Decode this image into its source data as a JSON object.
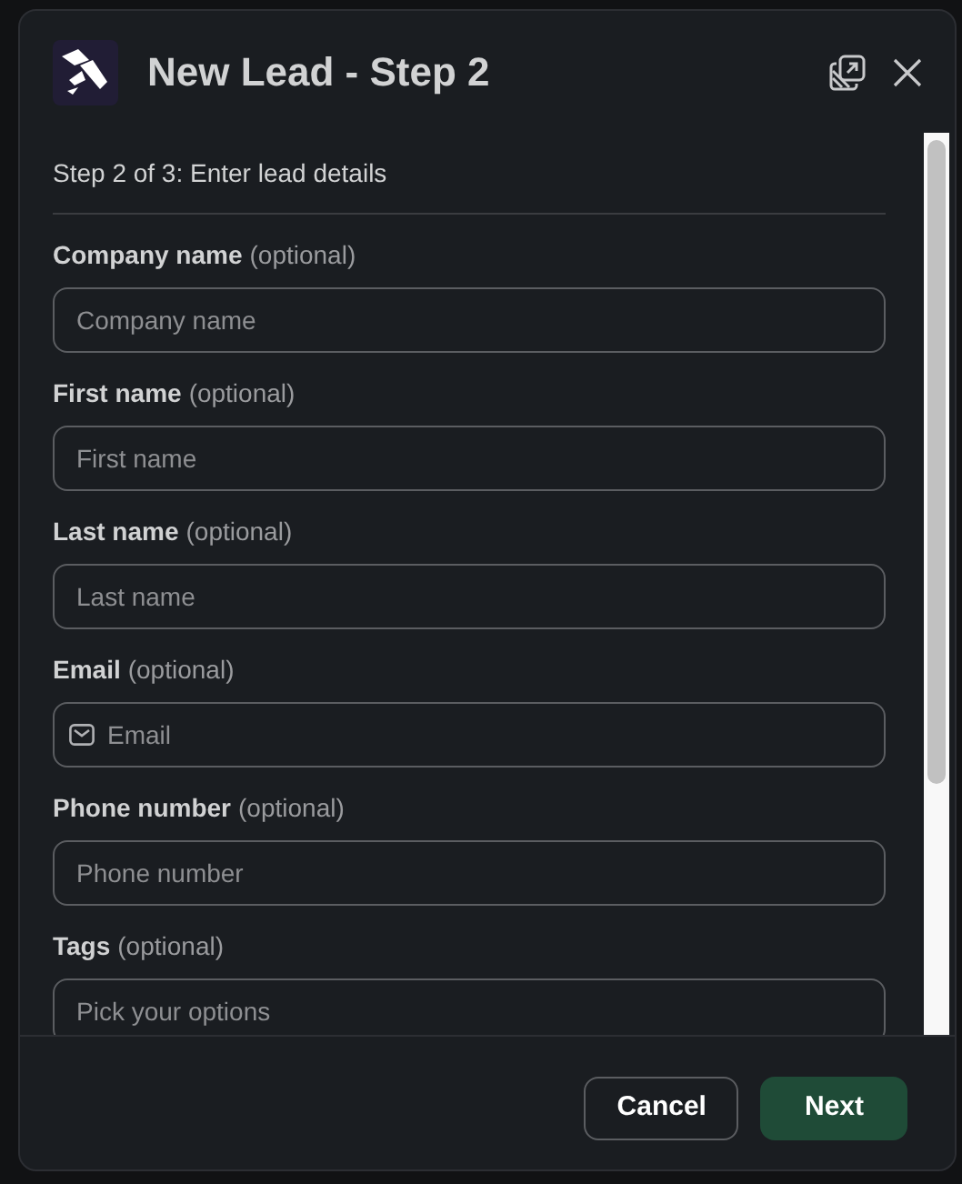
{
  "dialog": {
    "title": "New Lead - Step 2",
    "subtitle": "Step 2 of 3: Enter lead details"
  },
  "fields": [
    {
      "kind": "text",
      "label": "Company name",
      "hint": "(optional)",
      "placeholder": "Company name"
    },
    {
      "kind": "text",
      "label": "First name",
      "hint": "(optional)",
      "placeholder": "First name"
    },
    {
      "kind": "text",
      "label": "Last name",
      "hint": "(optional)",
      "placeholder": "Last name"
    },
    {
      "kind": "email",
      "label": "Email",
      "hint": "(optional)",
      "placeholder": "Email"
    },
    {
      "kind": "text",
      "label": "Phone number",
      "hint": "(optional)",
      "placeholder": "Phone number"
    },
    {
      "kind": "select",
      "label": "Tags",
      "hint": "(optional)",
      "placeholder": "Pick your options"
    }
  ],
  "buttons": [
    {
      "kind": "secondary",
      "label": "Cancel"
    },
    {
      "kind": "primary",
      "label": "Next"
    }
  ]
}
